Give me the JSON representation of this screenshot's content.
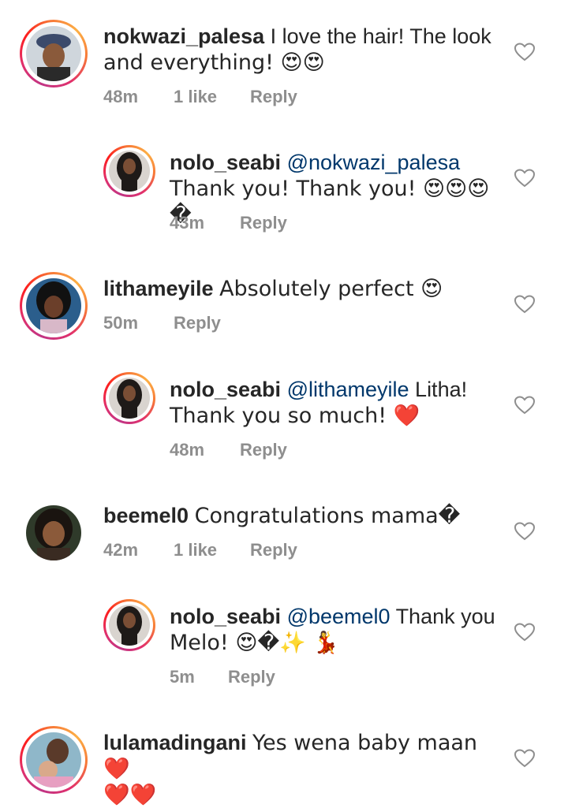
{
  "comments": [
    {
      "username": "nokwazi_palesa",
      "text_line1": "I love the hair! The look",
      "text_line2": "and everything! 😍😍",
      "time": "48m",
      "likes": "1 like",
      "reply": "Reply"
    },
    {
      "username": "nolo_seabi",
      "mention": "@nokwazi_palesa",
      "text_line2": "Thank you! Thank you! 😍😍😍�",
      "time": "43m",
      "reply": "Reply"
    },
    {
      "username": "lithameyile",
      "text_line1": "Absolutely perfect 😍",
      "time": "50m",
      "reply": "Reply"
    },
    {
      "username": "nolo_seabi",
      "mention": "@lithameyile",
      "text_line1": "Litha!",
      "text_line2": "Thank you so much! ❤️",
      "time": "48m",
      "reply": "Reply"
    },
    {
      "username": "beemel0",
      "text_line1": "Congratulations mama�",
      "time": "42m",
      "likes": "1 like",
      "reply": "Reply"
    },
    {
      "username": "nolo_seabi",
      "mention": "@beemel0",
      "text_line1": "Thank you",
      "text_line2": "Melo! 😍�✨ 💃",
      "time": "5m",
      "reply": "Reply"
    },
    {
      "username": "lulamadingani",
      "text_line1": "Yes wena baby maan ❤️",
      "text_line2": "❤️❤️",
      "time": "",
      "reply": ""
    }
  ],
  "colors": {
    "text": "#262626",
    "meta": "#8e8e8e",
    "mention": "#00376b",
    "ring_start": "#c13584",
    "ring_end": "#fcaf45"
  },
  "icons": {
    "like": "heart-outline-icon"
  }
}
